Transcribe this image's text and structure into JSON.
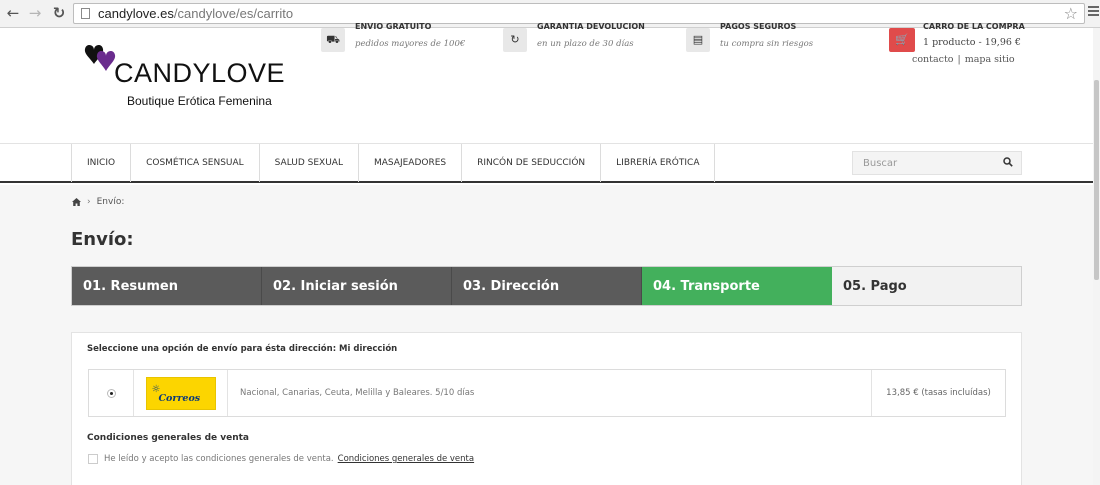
{
  "browser": {
    "url_domain": "candylove.es",
    "url_path": "/candylove/es/carrito"
  },
  "header": {
    "logo_name": "CANDYLOVE",
    "logo_tagline": "Boutique Erótica Femenina",
    "perks": [
      {
        "title": "ENVIO GRATUITO",
        "subtitle": "pedidos mayores de 100€",
        "icon": "truck-icon"
      },
      {
        "title": "GARANTIA DEVOLUCION",
        "subtitle": "en un plazo de 30 días",
        "icon": "refresh-icon"
      },
      {
        "title": "PAGOS SEGUROS",
        "subtitle": "tu compra sin riesgos",
        "icon": "credit-card-icon"
      }
    ],
    "cart": {
      "title": "CARRO DE LA COMPRA",
      "info": "1 producto - 19,96 €",
      "icon": "cart-icon"
    },
    "links": {
      "contact": "contacto",
      "separator": "|",
      "sitemap": "mapa sitio"
    }
  },
  "nav": {
    "items": [
      {
        "label": "INICIO"
      },
      {
        "label": "COSMÉTICA SENSUAL"
      },
      {
        "label": "SALUD SEXUAL"
      },
      {
        "label": "MASAJEADORES"
      },
      {
        "label": "RINCÓN DE SEDUCCIÓN"
      },
      {
        "label": "LIBRERÍA ERÓTICA"
      }
    ],
    "search_placeholder": "Buscar"
  },
  "breadcrumb": {
    "current": "Envío:"
  },
  "page": {
    "title": "Envío:"
  },
  "steps": [
    {
      "label": "01. Resumen",
      "state": "done"
    },
    {
      "label": "02. Iniciar sesión",
      "state": "done"
    },
    {
      "label": "03. Dirección",
      "state": "done"
    },
    {
      "label": "04. Transporte",
      "state": "active"
    },
    {
      "label": "05. Pago",
      "state": "future"
    }
  ],
  "shipping": {
    "heading": "Seleccione una opción de envío para ésta dirección: Mi dirección",
    "carrier": {
      "logo_text": "Correos",
      "description": "Nacional, Canarias, Ceuta, Melilla y Baleares. 5/10 días",
      "price": "13,85 € (tasas incluídas)",
      "selected": true
    }
  },
  "terms": {
    "title": "Condiciones generales de venta",
    "accept_text": "He leído y acepto las condiciones generales de venta.",
    "link_text": "Condiciones generales de venta",
    "checked": false
  },
  "colors": {
    "active_step": "#43b05c",
    "done_step": "#5b5b5b",
    "cart_accent": "#e04b4b",
    "correos_yellow": "#fcd500"
  }
}
